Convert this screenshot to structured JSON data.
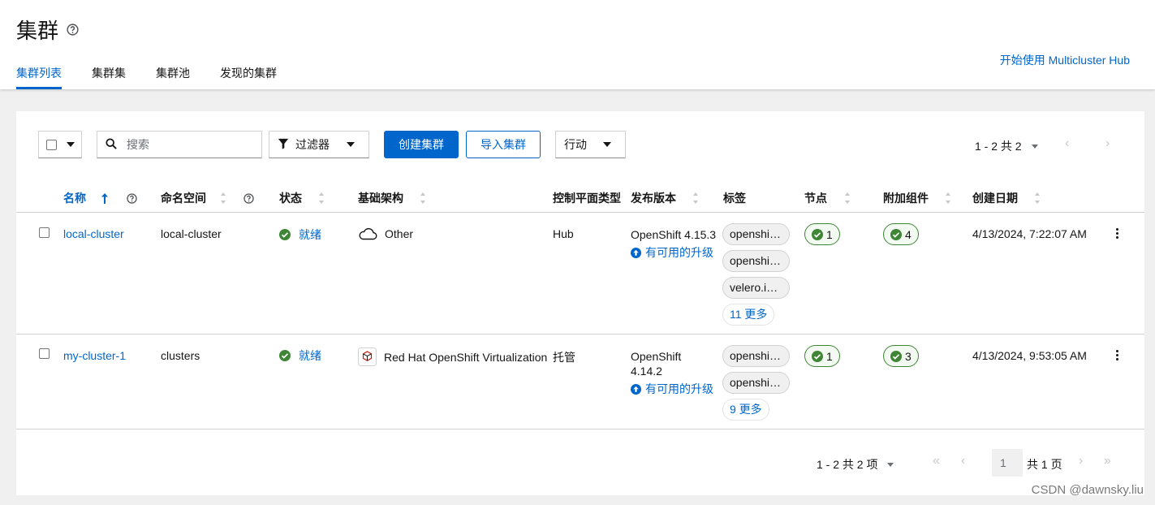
{
  "page": {
    "title": "集群",
    "get_started_link": "开始使用 Multicluster Hub",
    "tabs": [
      {
        "label": "集群列表",
        "active": true
      },
      {
        "label": "集群集",
        "active": false
      },
      {
        "label": "集群池",
        "active": false
      },
      {
        "label": "发现的集群",
        "active": false
      }
    ]
  },
  "toolbar": {
    "search_placeholder": "搜索",
    "filter_label": "过滤器",
    "create_button": "创建集群",
    "import_button": "导入集群",
    "actions_label": "行动",
    "pagination_text": "1 - 2 共 2"
  },
  "table": {
    "columns": {
      "name": "名称",
      "namespace": "命名空间",
      "status": "状态",
      "infrastructure": "基础架构",
      "control_plane": "控制平面类型",
      "distribution": "发布版本",
      "labels": "标签",
      "nodes": "节点",
      "addons": "附加组件",
      "created": "创建日期"
    },
    "rows": [
      {
        "name": "local-cluster",
        "namespace": "local-cluster",
        "status": "就绪",
        "infrastructure": "Other",
        "infra_icon": "cloud-icon",
        "control_plane": "Hub",
        "distribution_line1": "OpenShift 4.15.3",
        "distribution_line2": "",
        "upgrade_text": "有可用的升级",
        "labels": [
          "openshift...",
          "openshift...",
          "velero.io/..."
        ],
        "more_labels": "11 更多",
        "nodes": "1",
        "addons": "4",
        "created": "4/13/2024, 7:22:07 AM"
      },
      {
        "name": "my-cluster-1",
        "namespace": "clusters",
        "status": "就绪",
        "infrastructure": "Red Hat OpenShift Virtualization",
        "infra_icon": "openshift-virtualization-icon",
        "control_plane": "托管",
        "distribution_line1": "OpenShift",
        "distribution_line2": "4.14.2",
        "upgrade_text": "有可用的升级",
        "labels": [
          "openshift...",
          "openshift..."
        ],
        "more_labels": "9 更多",
        "nodes": "1",
        "addons": "3",
        "created": "4/13/2024, 9:53:05 AM"
      }
    ]
  },
  "pagination": {
    "range_text": "1 - 2 共 2 项",
    "current_page": "1",
    "total_pages_text": "共 1 页"
  },
  "watermark": "CSDN @dawnsky.liu",
  "colors": {
    "accent": "#0066cc",
    "success": "#3e8635",
    "background": "#f0f0f0"
  }
}
